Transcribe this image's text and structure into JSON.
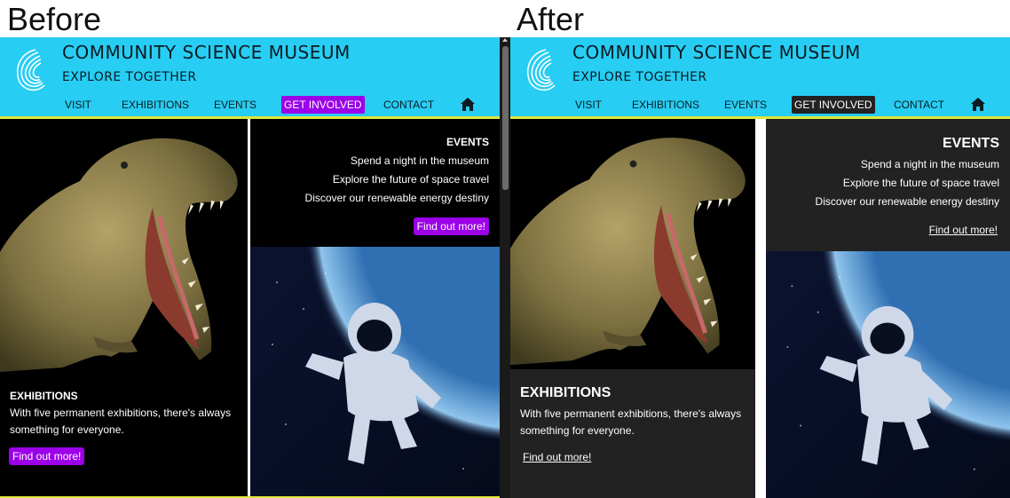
{
  "captions": {
    "before": "Before",
    "after": "After"
  },
  "site": {
    "title": "COMMUNITY SCIENCE MUSEUM",
    "tagline": "EXPLORE TOGETHER",
    "nav": [
      "VISIT",
      "EXHIBITIONS",
      "EVENTS",
      "GET INVOLVED",
      "CONTACT"
    ],
    "active_nav": "GET INVOLVED",
    "exhibitions": {
      "title": "EXHIBITIONS",
      "text": "With five permanent exhibitions, there's always something for everyone.",
      "cta": "Find out more!"
    },
    "events": {
      "title": "EVENTS",
      "items": [
        "Spend a night in the museum",
        "Explore the future of space travel",
        "Discover our renewable energy destiny"
      ],
      "cta": "Find out more!"
    }
  },
  "icons": {
    "logo": "swirl-logo-icon",
    "home": "home-icon"
  },
  "colors": {
    "header_bg": "#27cdf3",
    "header_text": "#0c1c22",
    "before_accent": "#9b00e8",
    "before_tile_bg": "#000000",
    "after_active_nav_bg": "#222222",
    "after_tile_bg": "#222222",
    "header_rule": "#dfe73a"
  }
}
